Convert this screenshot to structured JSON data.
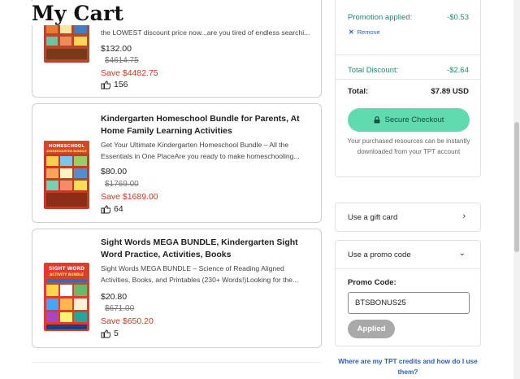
{
  "page": {
    "title": "My Cart"
  },
  "cart": {
    "items": [
      {
        "desc": "the LOWEST discount price now...are you tired of endless searchi...",
        "price": "$132.00",
        "original_price": "$4614.75",
        "save": "Save $4482.75",
        "ratings": "156"
      },
      {
        "title": "Kindergarten Homeschool Bundle for Parents, At Home Family Learning Activities",
        "desc": "Get Your Ultimate Kindergarten Homeschool Bundle – All the Essentials in One PlaceAre you ready to make homeschooling...",
        "thumb_text": "HOMESCHOOL KINDERGARTEN BUNDLE",
        "price": "$80.00",
        "original_price": "$1769.00",
        "save": "Save $1689.00",
        "ratings": "64"
      },
      {
        "title": "Sight Words MEGA BUNDLE, Kindergarten Sight Word Practice, Activities, Books",
        "desc": "Sight Words MEGA BUNDLE – Science of Reading Aligned Activities, Books, and Printables (230+ Words!)Looking for the...",
        "thumb_text": "SIGHT WORD ACTIVITY BUNDLE",
        "price": "$20.80",
        "original_price": "$671.00",
        "save": "Save $650.20",
        "ratings": "5"
      }
    ]
  },
  "summary": {
    "promotion_label": "Promotion applied:",
    "promotion_value": "-$0.53",
    "remove_label": "Remove",
    "total_discount_label": "Total Discount:",
    "total_discount_value": "-$2.64",
    "total_label": "Total:",
    "total_value": "$7.89 USD",
    "checkout_label": "Secure Checkout",
    "note": "Your purchased resources can be instantly downloaded from your TPT account"
  },
  "gift_card": {
    "label": "Use a gift card"
  },
  "promo": {
    "header_label": "Use a promo code",
    "field_label": "Promo Code:",
    "value": "BTSBONUS25",
    "applied_label": "Applied"
  },
  "credits_link": "Where are my TPT credits and how do I use them?",
  "colors": {
    "accent_green": "#5fdbaf",
    "discount_green": "#1b8a73",
    "save_red": "#d0361b",
    "link_blue": "#2b5fb8"
  },
  "icons": [
    "hand-rating-icon",
    "close-icon",
    "lock-icon",
    "chevron-right-icon",
    "chevron-down-icon"
  ]
}
